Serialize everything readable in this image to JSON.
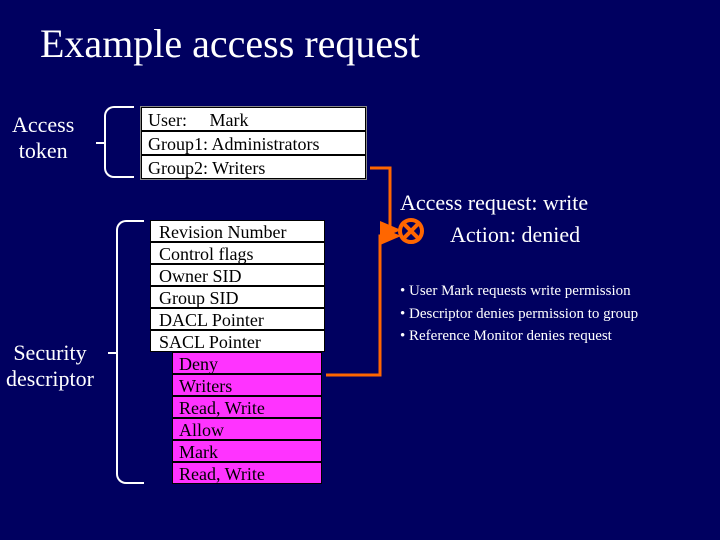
{
  "title": "Example access request",
  "labels": {
    "access_token": "Access\ntoken",
    "security_descriptor": "Security\ndescriptor"
  },
  "token": {
    "user": "User:     Mark",
    "group1": "Group1: Administrators",
    "group2": "Group2: Writers"
  },
  "descriptor": {
    "revision": "Revision Number",
    "flags": "Control flags",
    "owner": "Owner SID",
    "group": "Group SID",
    "dacl": "DACL Pointer",
    "sacl": "SACL Pointer",
    "ace_deny_type": "Deny",
    "ace_deny_sid": "Writers",
    "ace_deny_mask": "Read, Write",
    "ace_allow_type": "Allow",
    "ace_allow_sid": "Mark",
    "ace_allow_mask": "Read, Write"
  },
  "request": {
    "line": "Access request: write",
    "action": "Action: denied"
  },
  "bullets": {
    "b1": "User Mark requests write permission",
    "b2": "Descriptor denies permission to group",
    "b3": "Reference Monitor denies request"
  },
  "colors": {
    "bg": "#000060",
    "ace": "#ff33ff",
    "arrow": "#ff6600"
  }
}
